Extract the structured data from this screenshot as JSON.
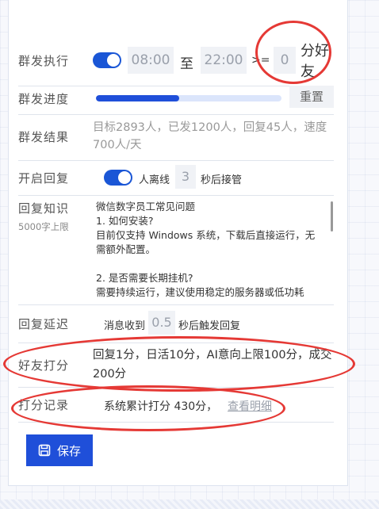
{
  "mass_send": {
    "label": "群发执行",
    "toggle_on": true,
    "start_time": "08:00",
    "to_label": "至",
    "end_time": "22:00",
    "gte_label": ">=",
    "score_threshold": "0",
    "score_suffix": "分好友"
  },
  "progress": {
    "label": "群发进度",
    "fraction": 0.45,
    "reset_label": "重置"
  },
  "result": {
    "label": "群发结果",
    "text": "目标2893人，已发1200人，回复45人，速度700人/天"
  },
  "auto_reply": {
    "label": "开启回复",
    "toggle_on": true,
    "offline_label": "人离线",
    "seconds": "3",
    "takeover_label": "秒后接管"
  },
  "knowledge": {
    "label": "回复知识",
    "hint": "5000字上限",
    "lines": [
      "微信数字员工常见问题",
      "1. 如何安装?",
      "目前仅支持 Windows 系统，下载后直接运行，无",
      "需额外配置。",
      "",
      "2. 是否需要长期挂机?",
      "需要持续运行，建议使用稳定的服务器或低功耗"
    ]
  },
  "reply_delay": {
    "label": "回复延迟",
    "prefix": "消息收到",
    "value": "0.5",
    "suffix": "秒后触发回复"
  },
  "friend_score": {
    "label": "好友打分",
    "text": "回复1分，日活10分，AI意向上限100分，成交200分"
  },
  "score_record": {
    "label": "打分记录",
    "text": "系统累计打分 430分，",
    "link": "查看明细"
  },
  "save": {
    "label": "保存"
  },
  "colors": {
    "accent": "#1f4fd9",
    "annotation": "#e53935"
  }
}
